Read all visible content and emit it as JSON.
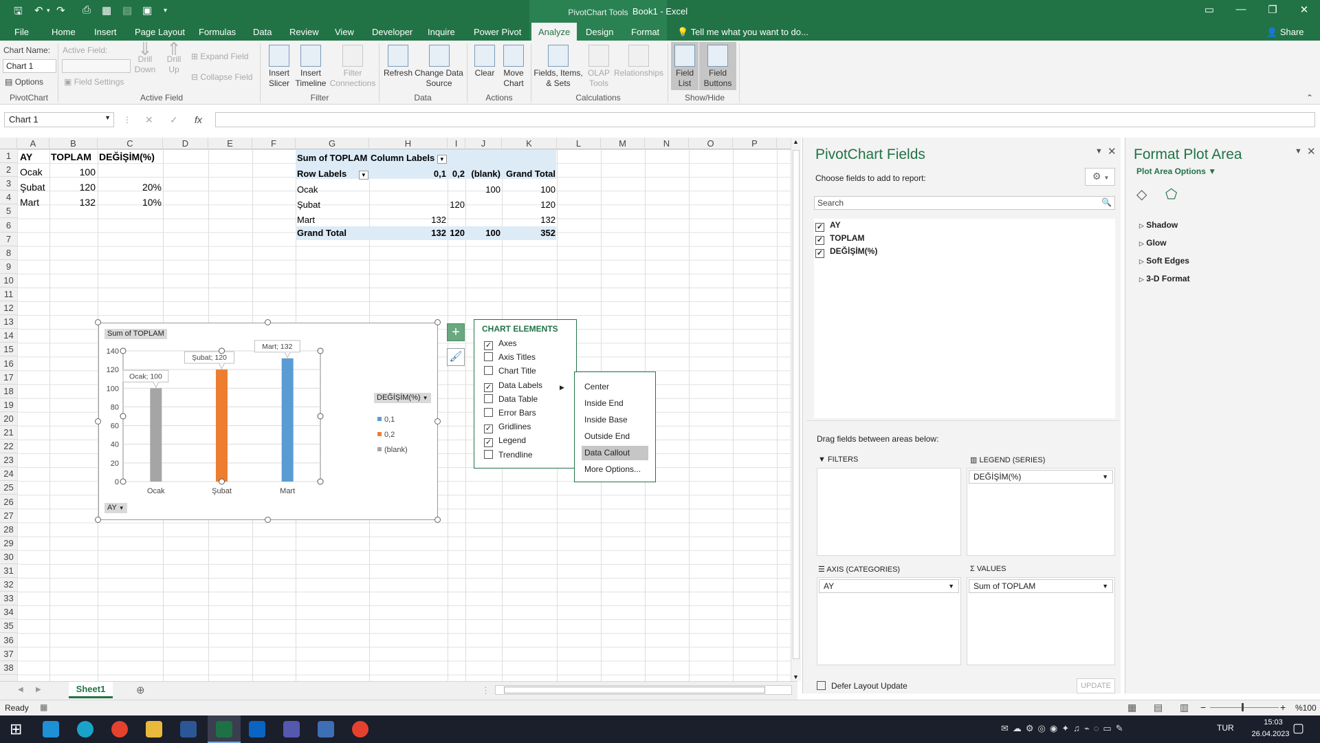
{
  "app": {
    "title": "Book1 - Excel",
    "context_tab_group": "PivotChart Tools",
    "tell_me": "Tell me what you want to do...",
    "share": "Share"
  },
  "tabs": [
    "File",
    "Home",
    "Insert",
    "Page Layout",
    "Formulas",
    "Data",
    "Review",
    "View",
    "Developer",
    "Inquire",
    "Power Pivot",
    "Analyze",
    "Design",
    "Format"
  ],
  "active_tab": "Analyze",
  "ribbon": {
    "chart_name_label": "Chart Name:",
    "chart_name_value": "Chart 1",
    "options": "Options",
    "pivotchart_group": "PivotChart",
    "active_field_label": "Active Field:",
    "field_settings": "Field Settings",
    "drill_down": "Drill Down",
    "drill_up": "Drill Up",
    "expand_field": "Expand Field",
    "collapse_field": "Collapse Field",
    "active_field_group": "Active Field",
    "insert_slicer": "Insert Slicer",
    "insert_timeline": "Insert Timeline",
    "filter_connections": "Filter Connections",
    "filter_group": "Filter",
    "refresh": "Refresh",
    "change_data_source": "Change Data Source",
    "data_group": "Data",
    "clear": "Clear",
    "move_chart": "Move Chart",
    "actions_group": "Actions",
    "fields_items_sets": "Fields, Items, & Sets",
    "olap_tools": "OLAP Tools",
    "relationships": "Relationships",
    "calculations_group": "Calculations",
    "field_list": "Field List",
    "field_buttons": "Field Buttons",
    "showhide_group": "Show/Hide"
  },
  "formula_bar": {
    "name_box": "Chart 1",
    "fx": "fx",
    "value": ""
  },
  "columns": [
    "A",
    "B",
    "C",
    "D",
    "E",
    "F",
    "G",
    "H",
    "I",
    "J",
    "K",
    "L",
    "M",
    "N",
    "O",
    "P"
  ],
  "rows": [
    "1",
    "2",
    "3",
    "4",
    "5",
    "6",
    "7",
    "8",
    "9",
    "10",
    "11",
    "12",
    "13",
    "14",
    "15",
    "16",
    "17",
    "18",
    "19",
    "20",
    "21",
    "22",
    "23",
    "24",
    "25",
    "26",
    "27",
    "28",
    "29",
    "30",
    "31",
    "32",
    "33",
    "34",
    "35",
    "36",
    "37",
    "38"
  ],
  "source_table": {
    "headers": [
      "AY",
      "TOPLAM",
      "DEĞİŞİM(%)"
    ],
    "rows": [
      [
        "Ocak",
        "100",
        ""
      ],
      [
        "Şubat",
        "120",
        "20%"
      ],
      [
        "Mart",
        "132",
        "10%"
      ]
    ]
  },
  "pivot_table": {
    "corner": "Sum of TOPLAM",
    "column_labels": "Column Labels",
    "row_labels": "Row Labels",
    "col_headers": [
      "0,1",
      "0,2",
      "(blank)",
      "Grand Total"
    ],
    "rows": [
      {
        "label": "Ocak",
        "c1": "",
        "c2": "",
        "c3": "100",
        "gt": "100"
      },
      {
        "label": "Şubat",
        "c1": "",
        "c2": "120",
        "c3": "",
        "gt": "120"
      },
      {
        "label": "Mart",
        "c1": "132",
        "c2": "",
        "c3": "",
        "gt": "132"
      }
    ],
    "grand_total": {
      "label": "Grand Total",
      "c1": "132",
      "c2": "120",
      "c3": "100",
      "gt": "352"
    }
  },
  "chart_data": {
    "type": "bar",
    "categories": [
      "Ocak",
      "Şubat",
      "Mart"
    ],
    "series": [
      {
        "name": "0,1",
        "values": [
          null,
          null,
          132
        ],
        "color": "#5b9bd5"
      },
      {
        "name": "0,2",
        "values": [
          null,
          120,
          null
        ],
        "color": "#ed7d31"
      },
      {
        "name": "(blank)",
        "values": [
          100,
          null,
          null
        ],
        "color": "#a5a5a5"
      }
    ],
    "field_button_value": "Sum of TOPLAM",
    "legend_field": "DEĞİŞİM(%)",
    "axis_field": "AY",
    "ylim": [
      0,
      140
    ],
    "yticks": [
      "0",
      "20",
      "40",
      "60",
      "80",
      "100",
      "120",
      "140"
    ],
    "data_labels": [
      "Ocak; 100",
      "Şubat; 120",
      "Mart; 132"
    ],
    "grid": true,
    "legend_position": "right"
  },
  "chart_elements": {
    "title": "CHART ELEMENTS",
    "items": [
      {
        "label": "Axes",
        "checked": true
      },
      {
        "label": "Axis Titles",
        "checked": false
      },
      {
        "label": "Chart Title",
        "checked": false
      },
      {
        "label": "Data Labels",
        "checked": true
      },
      {
        "label": "Data Table",
        "checked": false
      },
      {
        "label": "Error Bars",
        "checked": false
      },
      {
        "label": "Gridlines",
        "checked": true
      },
      {
        "label": "Legend",
        "checked": true
      },
      {
        "label": "Trendline",
        "checked": false
      }
    ]
  },
  "data_labels_menu": [
    "Center",
    "Inside End",
    "Inside Base",
    "Outside End",
    "Data Callout",
    "More Options..."
  ],
  "data_labels_highlighted": "Data Callout",
  "pivot_fields": {
    "title": "PivotChart Fields",
    "subtitle": "Choose fields to add to report:",
    "search_placeholder": "Search",
    "fields": [
      {
        "label": "AY",
        "checked": true
      },
      {
        "label": "TOPLAM",
        "checked": true
      },
      {
        "label": "DEĞİŞİM(%)",
        "checked": true
      }
    ],
    "drag_hint": "Drag fields between areas below:",
    "filters": "FILTERS",
    "legend_series": "LEGEND (SERIES)",
    "legend_value": "DEĞİŞİM(%)",
    "axis_categories": "AXIS (CATEGORIES)",
    "axis_value": "AY",
    "values": "VALUES",
    "values_value": "Sum of TOPLAM",
    "defer": "Defer Layout Update",
    "update": "UPDATE"
  },
  "format_pane": {
    "title": "Format Plot Area",
    "options": "Plot Area Options",
    "sections": [
      "Shadow",
      "Glow",
      "Soft Edges",
      "3-D Format"
    ]
  },
  "sheet": {
    "tab": "Sheet1"
  },
  "status": {
    "ready": "Ready",
    "zoom": "%100"
  },
  "taskbar": {
    "lang": "TUR",
    "time": "15:03",
    "date": "26.04.2023"
  }
}
